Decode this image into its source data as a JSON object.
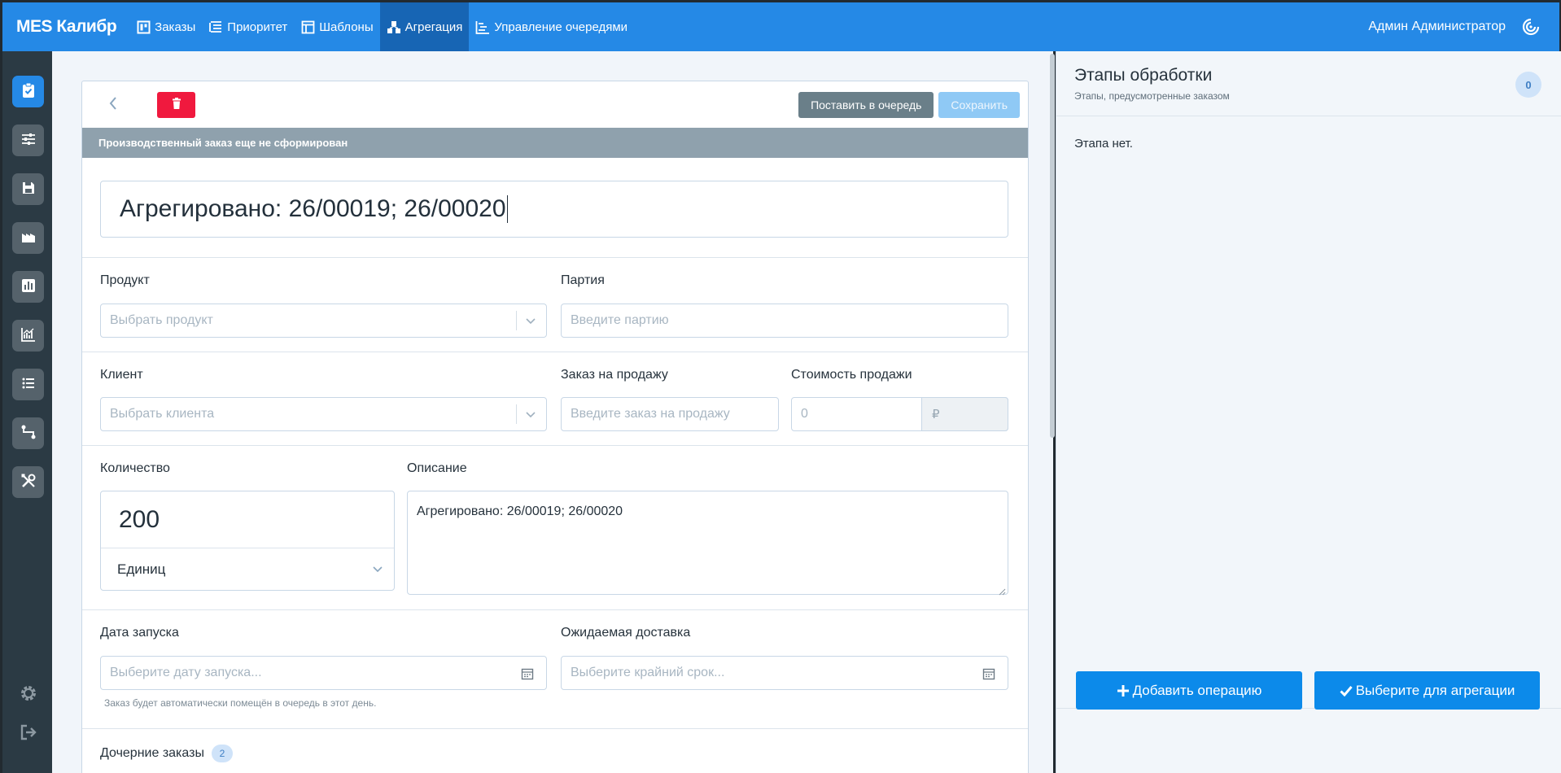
{
  "topbar": {
    "brand": "MES Калибр",
    "nav": [
      {
        "label": "Заказы",
        "icon": "board-icon"
      },
      {
        "label": "Приоритет",
        "icon": "priority-icon"
      },
      {
        "label": "Шаблоны",
        "icon": "template-icon"
      },
      {
        "label": "Агрегация",
        "icon": "aggregation-icon",
        "active": true
      },
      {
        "label": "Управление очередями",
        "icon": "queue-icon"
      }
    ],
    "user": "Админ Администратор"
  },
  "card": {
    "queue_label": "Поставить в очередь",
    "save_label": "Сохранить",
    "status": "Производственный заказ еще не сформирован",
    "title_value": "Агрегировано: 26/00019; 26/00020",
    "product": {
      "label": "Продукт",
      "placeholder": "Выбрать продукт"
    },
    "batch": {
      "label": "Партия",
      "placeholder": "Введите партию"
    },
    "client": {
      "label": "Клиент",
      "placeholder": "Выбрать клиента"
    },
    "sales_order": {
      "label": "Заказ на продажу",
      "placeholder": "Введите заказ на продажу"
    },
    "sale_price": {
      "label": "Стоимость продажи",
      "placeholder": "0",
      "currency": "₽"
    },
    "quantity": {
      "label": "Количество",
      "value": "200",
      "unit": "Единиц"
    },
    "description": {
      "label": "Описание",
      "value": "Агрегировано: 26/00019; 26/00020"
    },
    "start_date": {
      "label": "Дата запуска",
      "placeholder": "Выберите дату запуска...",
      "hint": "Заказ будет автоматически помещён в очередь в этот день."
    },
    "delivery": {
      "label": "Ожидаемая доставка",
      "placeholder": "Выберите крайний срок..."
    },
    "children": {
      "label": "Дочерние заказы",
      "count": "2"
    }
  },
  "side": {
    "title": "Этапы обработки",
    "subtitle": "Этапы, предусмотренные заказом",
    "count": "0",
    "empty": "Этапа нет.",
    "add_label": "Добавить операцию",
    "select_label": "Выберите для агрегации"
  },
  "colors": {
    "accent": "#2589e6",
    "danger": "#f0193e",
    "primary_button": "#0c8aea"
  }
}
